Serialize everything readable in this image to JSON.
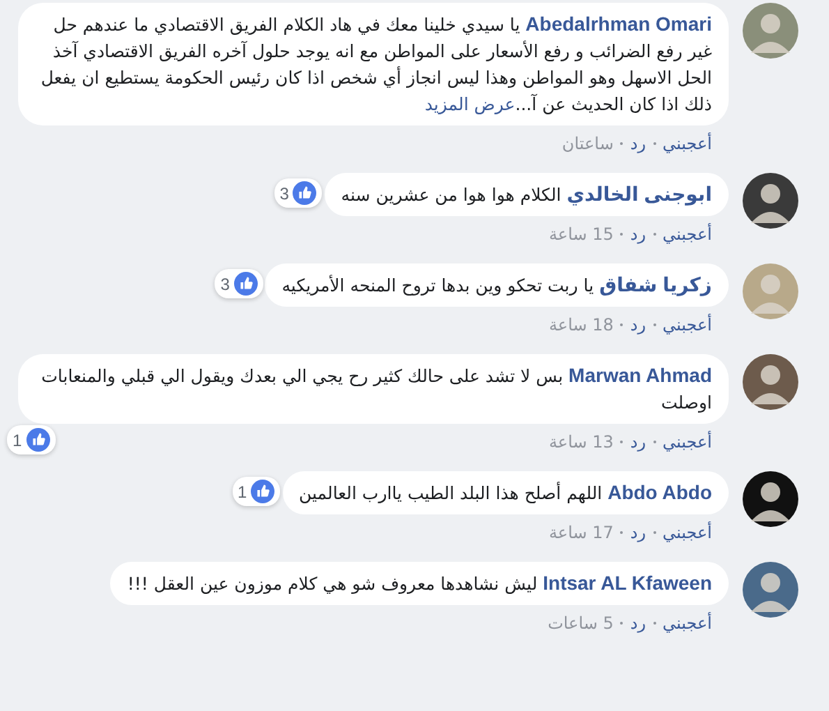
{
  "comments": [
    {
      "author": "Abedalrhman Omari",
      "text": "يا سيدي خلينا معك في هاد الكلام الفريق الاقتصادي ما عندهم حل غير رفع الضرائب و رفع الأسعار على المواطن مع انه يوجد حلول آخره الفريق الاقتصادي آخذ الحل الاسهل وهو المواطن وهذا ليس انجاز أي شخص اذا كان رئيس الحكومة يستطيع ان يفعل ذلك اذا كان الحديث عن آ...",
      "see_more": "عرض المزيد",
      "like": "أعجبني",
      "reply": "رد",
      "time": "ساعتان"
    },
    {
      "author": "ابوجنى الخالدي",
      "text": "الكلام هوا هوا من عشرين سنه",
      "like": "أعجبني",
      "reply": "رد",
      "time": "15 ساعة",
      "reactions": {
        "count": "3",
        "kind": "side"
      }
    },
    {
      "author": "زكريا شفاق",
      "text": "يا ربت تحكو وين بدها تروح المنحه الأمريكيه",
      "like": "أعجبني",
      "reply": "رد",
      "time": "18 ساعة",
      "reactions": {
        "count": "3",
        "kind": "side"
      }
    },
    {
      "author": "Marwan Ahmad",
      "text": "بس لا تشد على حالك كثير رح يجي الي بعدك ويقول الي قبلي والمنعابات اوصلت",
      "like": "أعجبني",
      "reply": "رد",
      "time": "13 ساعة",
      "reactions": {
        "count": "1",
        "kind": "below"
      }
    },
    {
      "author": "Abdo Abdo",
      "text": "اللهم أصلح هذا البلد الطيب ياارب العالمين",
      "like": "أعجبني",
      "reply": "رد",
      "time": "17 ساعة",
      "reactions": {
        "count": "1",
        "kind": "side"
      }
    },
    {
      "author": "Intsar AL Kfaween",
      "text": "ليش نشاهدها معروف شو هي كلام موزون عين العقل !!!",
      "like": "أعجبني",
      "reply": "رد",
      "time": "5 ساعات"
    }
  ]
}
